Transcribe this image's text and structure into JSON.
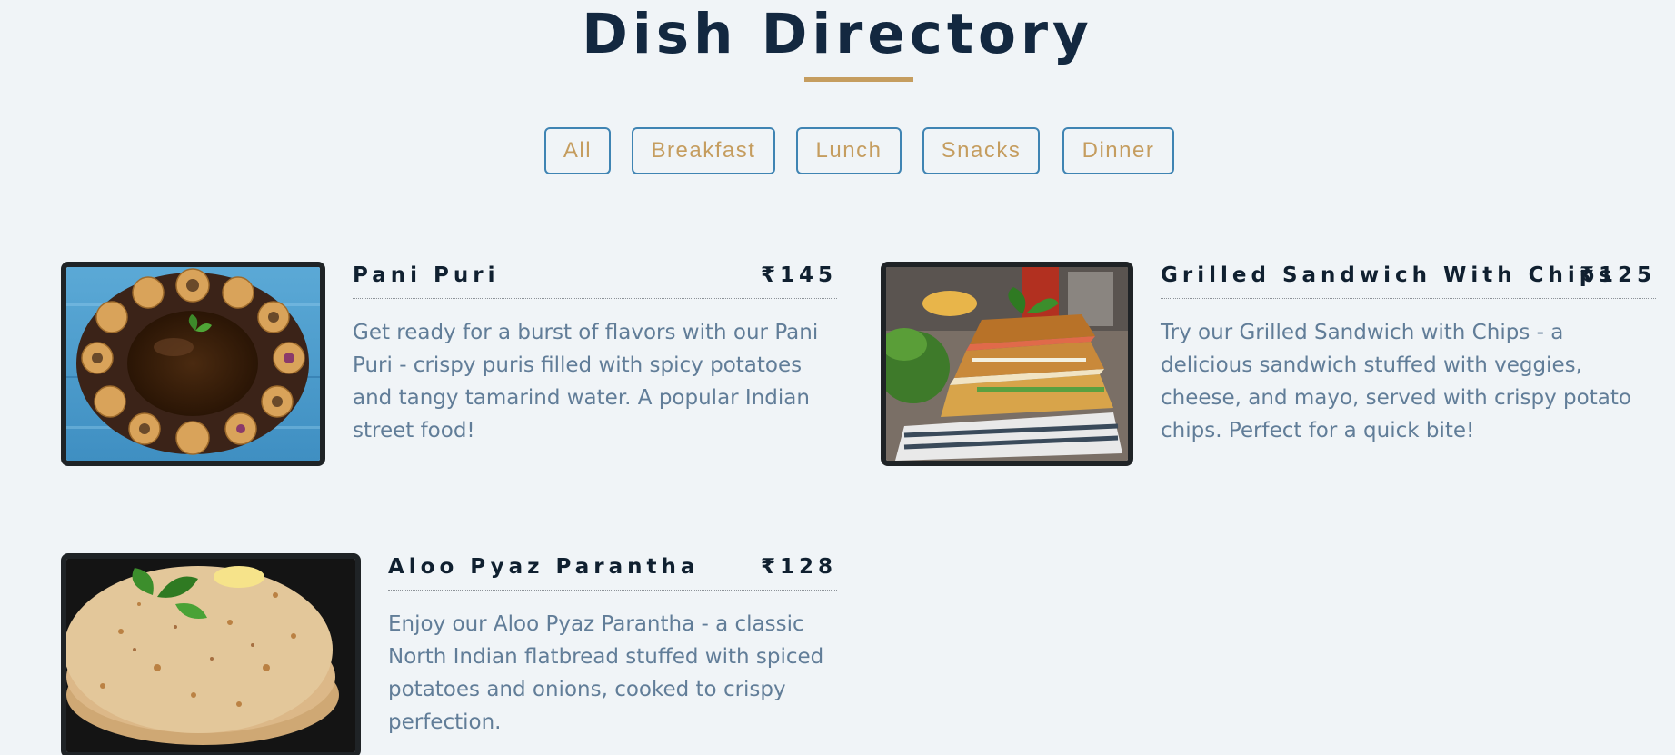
{
  "header": {
    "title": "Dish Directory"
  },
  "filters": [
    {
      "label": "All"
    },
    {
      "label": "Breakfast"
    },
    {
      "label": "Lunch"
    },
    {
      "label": "Snacks"
    },
    {
      "label": "Dinner"
    }
  ],
  "menu": [
    {
      "name": "Pani Puri",
      "price": "₹145",
      "description": "Get ready for a burst of flavors with our Pani Puri - crispy puris filled with spicy potatoes and tangy tamarind water. A popular Indian street food!"
    },
    {
      "name": "Grilled Sandwich With Chips",
      "price": "₹125",
      "description": "Try our Grilled Sandwich with Chips - a delicious sandwich stuffed with veggies, cheese, and mayo, served with crispy potato chips. Perfect for a quick bite!"
    },
    {
      "name": "Aloo Pyaz Parantha",
      "price": "₹128",
      "description": "Enjoy our Aloo Pyaz Parantha - a classic North Indian flatbread stuffed with spiced potatoes and onions, cooked to crispy perfection."
    }
  ],
  "colors": {
    "background": "#f0f4f7",
    "title": "#132840",
    "accent_gold": "#c59d5f",
    "button_border": "#3f84b3",
    "description": "#617d98"
  }
}
